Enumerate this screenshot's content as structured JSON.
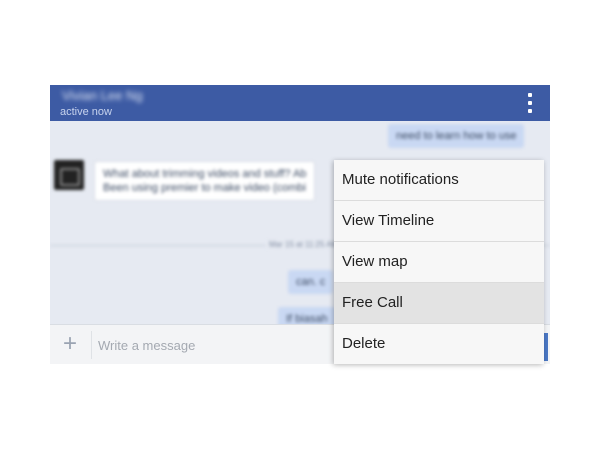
{
  "header": {
    "contact_name": "Vivian Lee Ng",
    "status": "active now",
    "overflow_icon": "more-vertical-icon"
  },
  "thread": {
    "outgoing_top": "need to learn how to use",
    "incoming_line1": "What about trimming videos and stuff? Ab",
    "incoming_line2": "Been using premier to make video (combi",
    "timestamp": "Mar 15 at 11:25 AM",
    "outgoing_mid": "can. c",
    "outgoing_low": "If biasah"
  },
  "composer": {
    "add_icon": "plus-icon",
    "placeholder": "Write a message"
  },
  "menu": {
    "items": [
      "Mute notifications",
      "View Timeline",
      "View map",
      "Free Call",
      "Delete"
    ],
    "highlighted": "Free Call"
  }
}
